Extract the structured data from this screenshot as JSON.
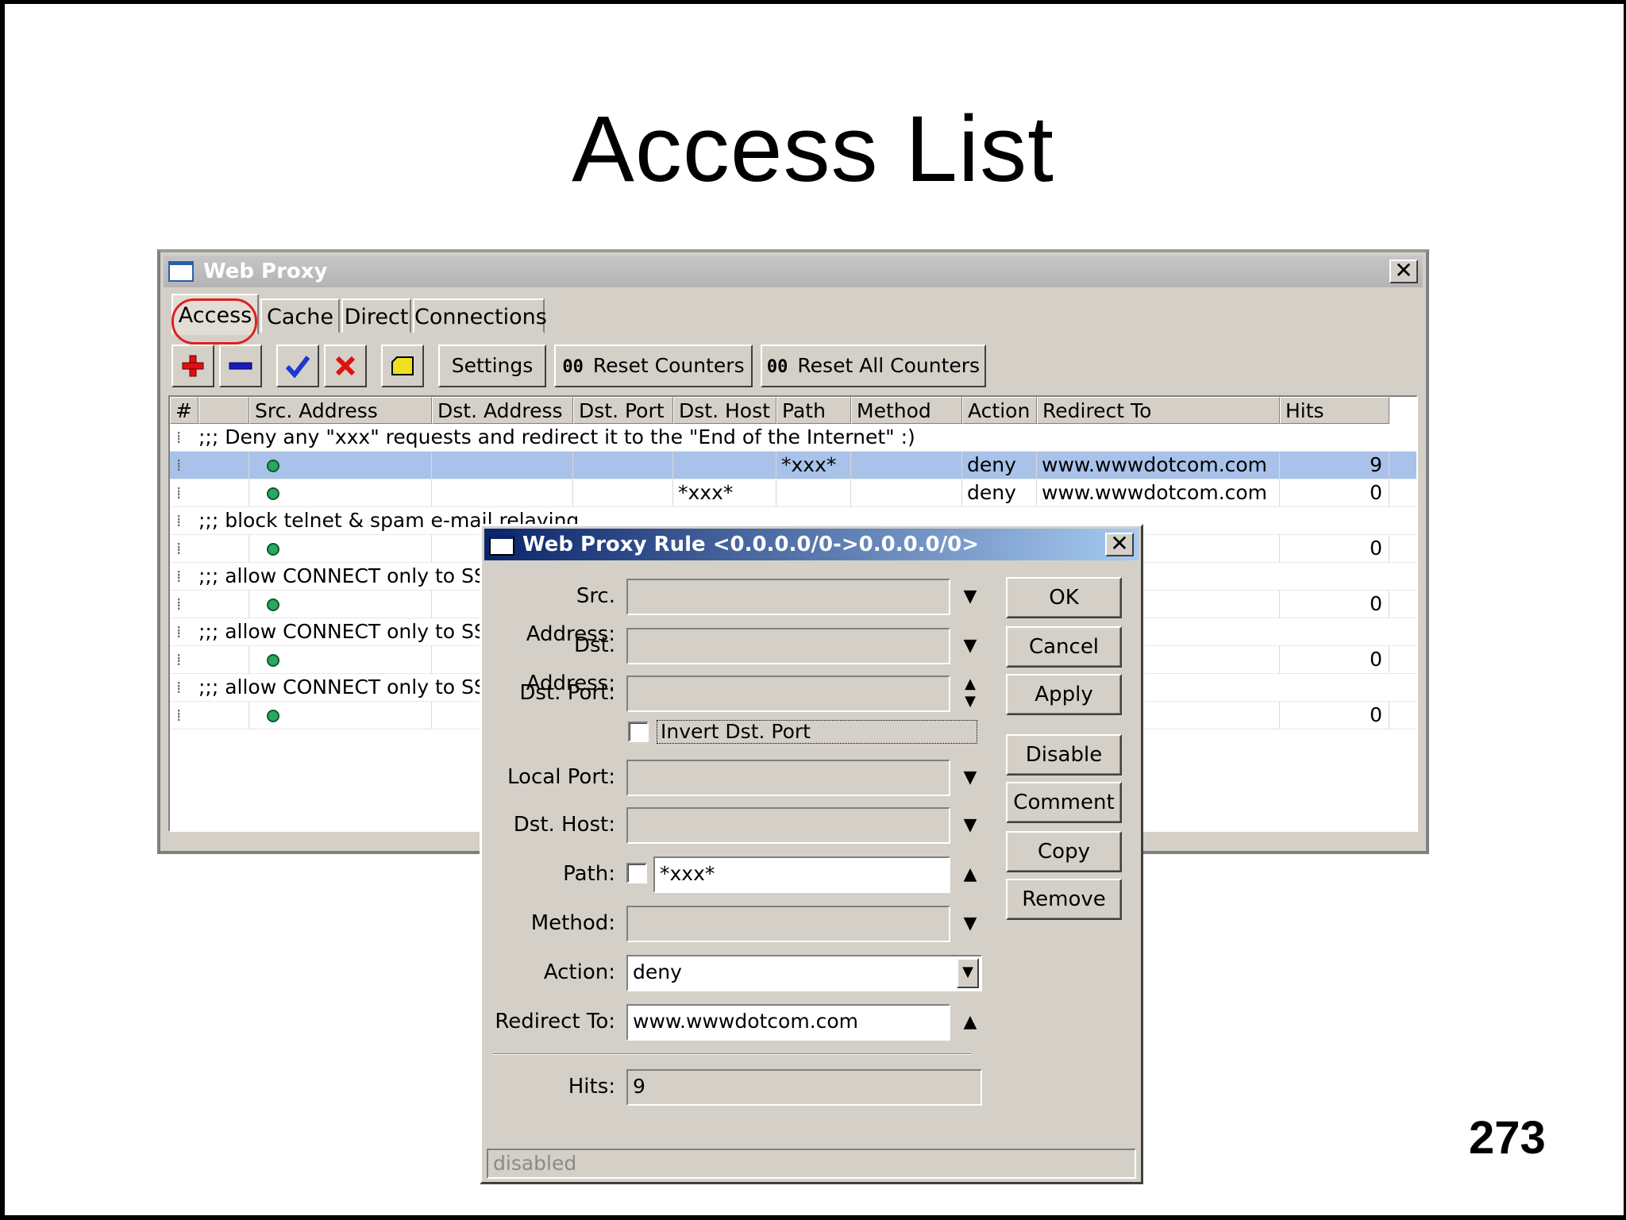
{
  "slide": {
    "title": "Access List",
    "page_number": "273"
  },
  "window": {
    "title": "Web Proxy",
    "tabs": [
      {
        "label": "Access",
        "active": true
      },
      {
        "label": "Cache"
      },
      {
        "label": "Direct"
      },
      {
        "label": "Connections"
      }
    ],
    "toolbar": {
      "settings_label": "Settings",
      "counter_icon": "00",
      "reset_counters_label": "Reset Counters",
      "reset_all_counters_label": "Reset All Counters",
      "icons": [
        "add-icon",
        "remove-icon",
        "enable-check-icon",
        "disable-x-icon",
        "comment-note-icon"
      ]
    },
    "columns": [
      "#",
      "",
      "Src. Address",
      "Dst. Address",
      "Dst. Port",
      "Dst. Host",
      "Path",
      "Method",
      "Action",
      "Redirect To",
      "Hits"
    ],
    "rows": [
      {
        "type": "comment",
        "text": ";;; Deny any \"xxx\" requests and redirect it to the \"End of the Internet\" :)"
      },
      {
        "type": "rule",
        "selected": true,
        "dst_host": "",
        "path": "*xxx*",
        "action": "deny",
        "redirect_to": "www.wwwdotcom.com",
        "hits": "9"
      },
      {
        "type": "rule",
        "dst_host": "*xxx*",
        "path": "",
        "action": "deny",
        "redirect_to": "www.wwwdotcom.com",
        "hits": "0"
      },
      {
        "type": "comment",
        "text": ";;; block telnet & spam e-mail relaying"
      },
      {
        "type": "rule",
        "hits": "0"
      },
      {
        "type": "comment",
        "text": ";;; allow CONNECT only to SSL"
      },
      {
        "type": "rule",
        "hits": "0"
      },
      {
        "type": "comment",
        "text": ";;; allow CONNECT only to SSL"
      },
      {
        "type": "rule",
        "hits": "0"
      },
      {
        "type": "comment",
        "text": ";;; allow CONNECT only to SSL"
      },
      {
        "type": "rule",
        "hits": "0"
      }
    ]
  },
  "dialog": {
    "title": "Web Proxy Rule <0.0.0.0/0->0.0.0.0/0>",
    "labels": {
      "src_address": "Src. Address:",
      "dst_address": "Dst. Address:",
      "dst_port": "Dst. Port:",
      "invert_dst_port": "Invert Dst. Port",
      "local_port": "Local Port:",
      "dst_host": "Dst. Host:",
      "path": "Path:",
      "method": "Method:",
      "action": "Action:",
      "redirect_to": "Redirect To:",
      "hits": "Hits:"
    },
    "values": {
      "src_address": "",
      "dst_address": "",
      "dst_port": "",
      "local_port": "",
      "dst_host": "",
      "path": "*xxx*",
      "method": "",
      "action": "deny",
      "redirect_to": "www.wwwdotcom.com",
      "hits": "9"
    },
    "buttons": [
      "OK",
      "Cancel",
      "Apply",
      "Disable",
      "Comment",
      "Copy",
      "Remove"
    ],
    "status": "disabled"
  }
}
